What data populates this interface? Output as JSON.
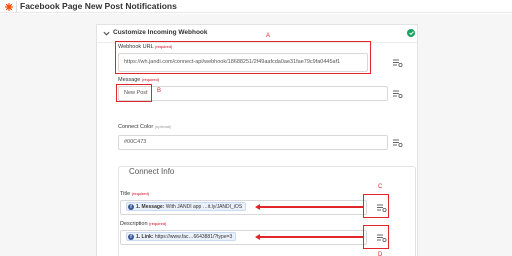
{
  "header": {
    "title": "Facebook Page New Post Notifications"
  },
  "section": {
    "title": "Customize Incoming Webhook"
  },
  "webhook_url": {
    "label": "Webhook URL",
    "required": "(required)",
    "value": "https://wh.jandi.com/connect-api/webhook/18688251/2f49aafcda0ae31fae79c9fa0445af1",
    "annotation": "A"
  },
  "message": {
    "label": "Message",
    "required": "(required)",
    "value": "New Post",
    "annotation": "B"
  },
  "connect_color": {
    "label": "Connect Color",
    "optional": "(optional)",
    "value": "#00C473"
  },
  "connect_info": {
    "title": "Connect Info",
    "title_field": {
      "label": "Title",
      "required": "(required)",
      "pill_strong": "1. Message:",
      "pill_text": "With JANDI app …it.ly/JANDI_iOS",
      "annotation": "C"
    },
    "description_field": {
      "label": "Description",
      "required": "(required)",
      "pill_strong": "1. Link:",
      "pill_text": "https://www.fac…6643881/?type=3",
      "annotation": "D"
    }
  },
  "colors": {
    "status_ok": "#1aa260",
    "annotation": "#e0262b",
    "facebook": "#3b5998"
  }
}
